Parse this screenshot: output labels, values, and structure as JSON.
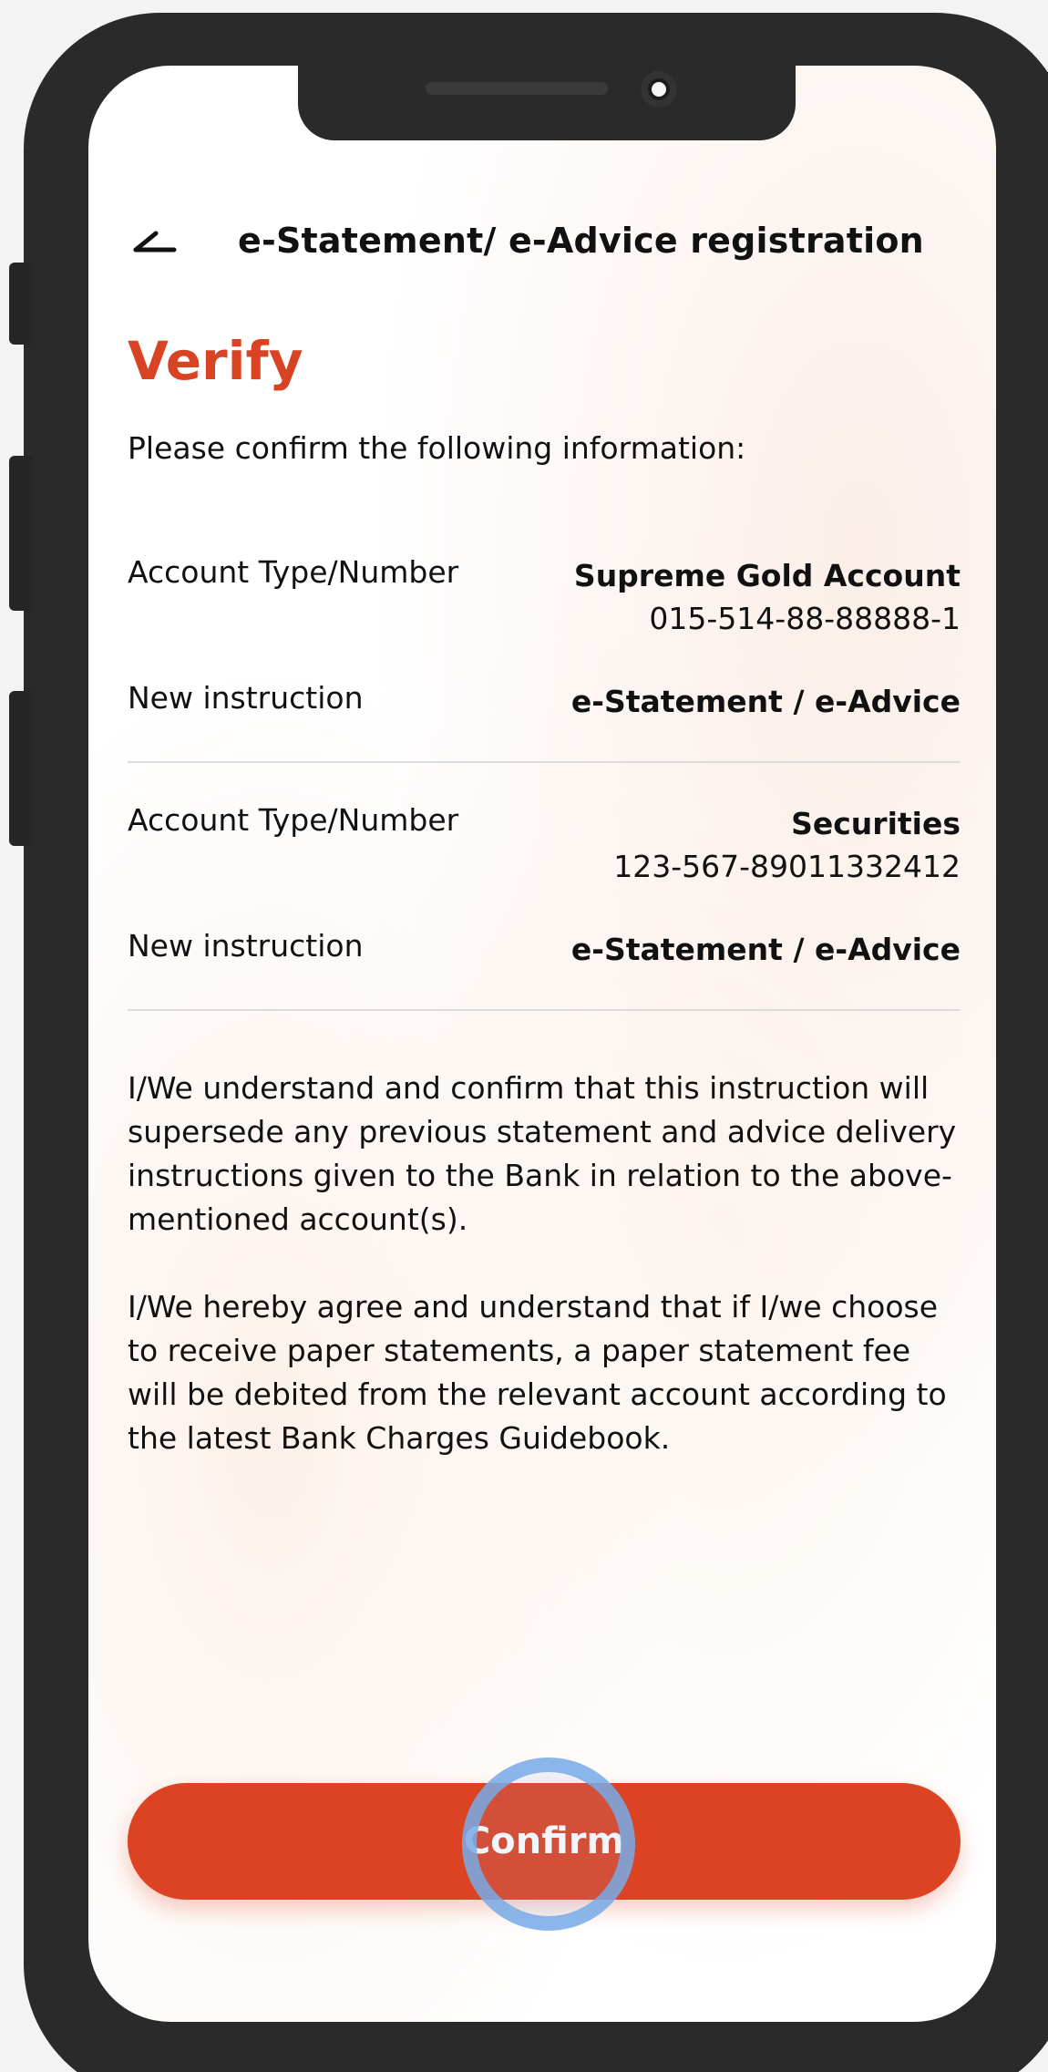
{
  "header": {
    "title": "e-Statement/ e-Advice registration",
    "back_icon": "back-arrow-icon"
  },
  "page": {
    "title": "Verify",
    "subtitle": "Please confirm the following information:"
  },
  "accounts": [
    {
      "label": "Account Type/Number",
      "type": "Supreme Gold Account",
      "number": "015-514-88-88888-1",
      "instruction_label": "New instruction",
      "instruction_value": "e-Statement / e-Advice"
    },
    {
      "label": "Account Type/Number",
      "type": "Securities",
      "number": "123-567-89011332412",
      "instruction_label": "New instruction",
      "instruction_value": "e-Statement / e-Advice"
    }
  ],
  "disclaimers": [
    "I/We understand and confirm that this instruction will supersede any previous statement and advice delivery instructions given to the Bank in relation to the above-mentioned account(s).",
    "I/We hereby agree and understand that if I/we choose to receive paper statements, a paper statement fee will be debited from the relevant account according to the latest Bank Charges Guidebook."
  ],
  "actions": {
    "confirm_label": "Confirm"
  },
  "colors": {
    "accent": "#d84323",
    "button": "#dc4322",
    "tap_indicator": "#78aae6"
  }
}
